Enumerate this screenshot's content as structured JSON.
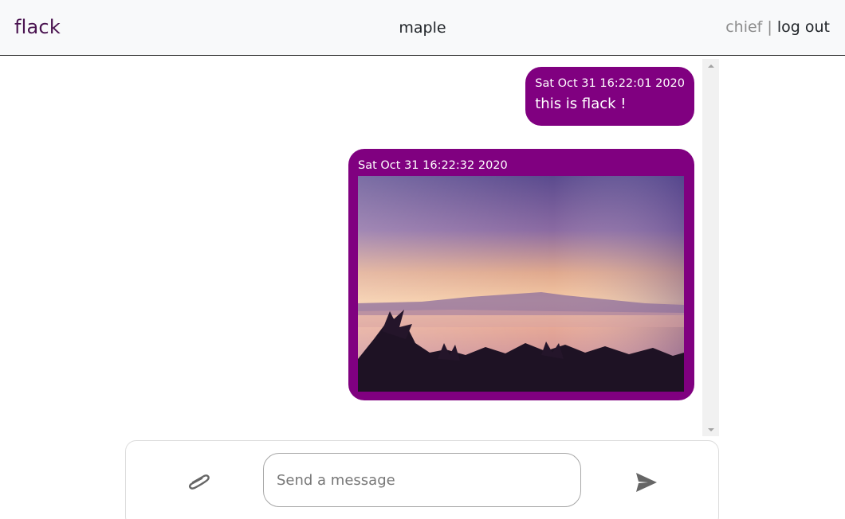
{
  "navbar": {
    "brand": "flack",
    "channel": "maple",
    "username": "chief",
    "separator": "|",
    "logout_label": "log out"
  },
  "messages": [
    {
      "timestamp": "Sat Oct 31 16:22:01 2020",
      "text": "this is flack !"
    },
    {
      "timestamp": "Sat Oct 31 16:22:32 2020",
      "attachment": "sunset-landscape-photo"
    }
  ],
  "composer": {
    "attach_icon": "paperclip-icon",
    "input_placeholder": "Send a message",
    "input_value": "",
    "send_icon": "send-icon"
  },
  "colors": {
    "bubble": "#800080",
    "brand": "#4a1450",
    "navbar_bg": "#f8f9fa"
  }
}
